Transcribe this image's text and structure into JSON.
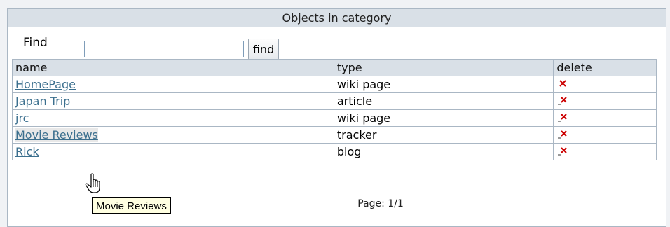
{
  "panel": {
    "title": "Objects in category"
  },
  "find": {
    "label": "Find",
    "input_value": "",
    "button_label": "find"
  },
  "table": {
    "headers": {
      "name": "name",
      "type": "type",
      "delete": "delete"
    },
    "rows": [
      {
        "name": "HomePage",
        "type": "wiki page"
      },
      {
        "name": "Japan Trip",
        "type": "article"
      },
      {
        "name": "jrc",
        "type": "wiki page"
      },
      {
        "name": "Movie Reviews",
        "type": "tracker"
      },
      {
        "name": "Rick",
        "type": "blog"
      }
    ]
  },
  "pager": {
    "text": "Page: 1/1"
  },
  "tooltip": {
    "text": "Movie Reviews"
  },
  "colors": {
    "link": "#3b6f8e",
    "header_bg": "#d9e0e7",
    "border": "#aab7c4",
    "delete_red": "#cc0000",
    "tooltip_bg": "#ffffe1"
  },
  "icons": {
    "delete": "delete-x-icon",
    "cursor": "hand-pointer-icon"
  }
}
